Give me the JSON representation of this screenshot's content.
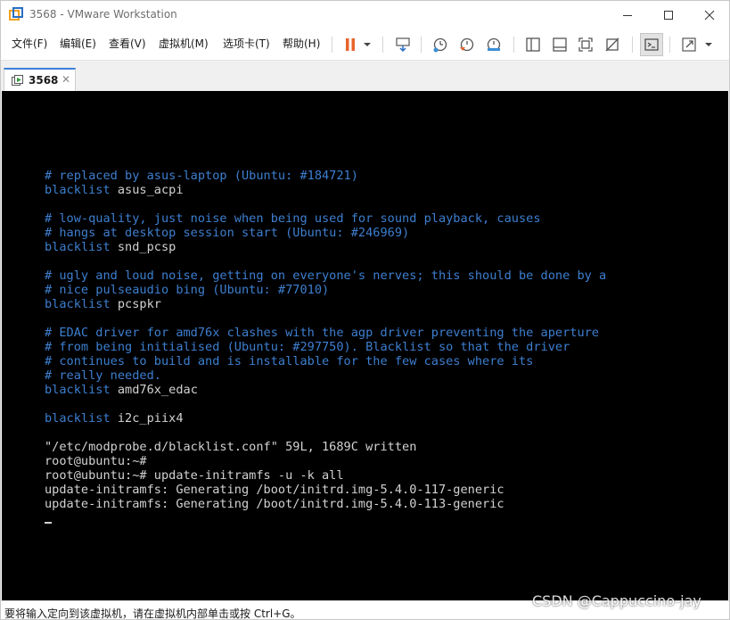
{
  "window": {
    "title": "3568 - VMware Workstation",
    "controls": {
      "minimize_icon": "minimize-icon",
      "maximize_icon": "maximize-icon",
      "close_icon": "close-icon"
    }
  },
  "menu": {
    "items": [
      {
        "label": "文件(F)"
      },
      {
        "label": "编辑(E)"
      },
      {
        "label": "查看(V)"
      },
      {
        "label": "虚拟机(M)"
      },
      {
        "label": "选项卡(T)"
      },
      {
        "label": "帮助(H)"
      }
    ]
  },
  "toolbar": {
    "pause_color": "#e8642c",
    "buttons": [
      "pause-icon",
      "dropdown-icon",
      "send-ctrl-alt-del-icon",
      "snapshot-icon",
      "revert-snapshot-icon",
      "snapshot-manager-icon",
      "show-library-icon",
      "thumbnail-bar-icon",
      "full-screen-icon",
      "unity-icon",
      "console-view-icon",
      "stretch-guest-icon",
      "dropdown-icon"
    ]
  },
  "tabs": [
    {
      "label": "3568",
      "active": true,
      "close": "✕"
    }
  ],
  "console": {
    "lines": [
      {
        "kind": "comment",
        "text": "# replaced by asus-laptop (Ubuntu: #184721)"
      },
      {
        "kind": "kw",
        "kw": "blacklist",
        "text": " asus_acpi"
      },
      {
        "kind": "blank",
        "text": ""
      },
      {
        "kind": "comment",
        "text": "# low-quality, just noise when being used for sound playback, causes"
      },
      {
        "kind": "comment",
        "text": "# hangs at desktop session start (Ubuntu: #246969)"
      },
      {
        "kind": "kw",
        "kw": "blacklist",
        "text": " snd_pcsp"
      },
      {
        "kind": "blank",
        "text": ""
      },
      {
        "kind": "comment",
        "text": "# ugly and loud noise, getting on everyone's nerves; this should be done by a"
      },
      {
        "kind": "comment",
        "text": "# nice pulseaudio bing (Ubuntu: #77010)"
      },
      {
        "kind": "kw",
        "kw": "blacklist",
        "text": " pcspkr"
      },
      {
        "kind": "blank",
        "text": ""
      },
      {
        "kind": "comment",
        "text": "# EDAC driver for amd76x clashes with the agp driver preventing the aperture"
      },
      {
        "kind": "comment",
        "text": "# from being initialised (Ubuntu: #297750). Blacklist so that the driver"
      },
      {
        "kind": "comment",
        "text": "# continues to build and is installable for the few cases where its"
      },
      {
        "kind": "comment",
        "text": "# really needed."
      },
      {
        "kind": "kw",
        "kw": "blacklist",
        "text": " amd76x_edac"
      },
      {
        "kind": "blank",
        "text": ""
      },
      {
        "kind": "kw",
        "kw": "blacklist",
        "text": " i2c_piix4"
      },
      {
        "kind": "blank",
        "text": ""
      },
      {
        "kind": "text",
        "text": "\"/etc/modprobe.d/blacklist.conf\" 59L, 1689C written"
      },
      {
        "kind": "text",
        "text": "root@ubuntu:~#"
      },
      {
        "kind": "text",
        "text": "root@ubuntu:~# update-initramfs -u -k all"
      },
      {
        "kind": "text",
        "text": "update-initramfs: Generating /boot/initrd.img-5.4.0-117-generic"
      },
      {
        "kind": "text",
        "text": "update-initramfs: Generating /boot/initrd.img-5.4.0-113-generic"
      }
    ],
    "colors": {
      "background": "#000000",
      "comment": "#3d7fd0",
      "text": "#d2d2d2"
    }
  },
  "status": {
    "text": "要将输入定向到该虚拟机，请在虚拟机内部单击或按 Ctrl+G。"
  },
  "watermark": {
    "text": "CSDN @Cappuccino-jay"
  }
}
